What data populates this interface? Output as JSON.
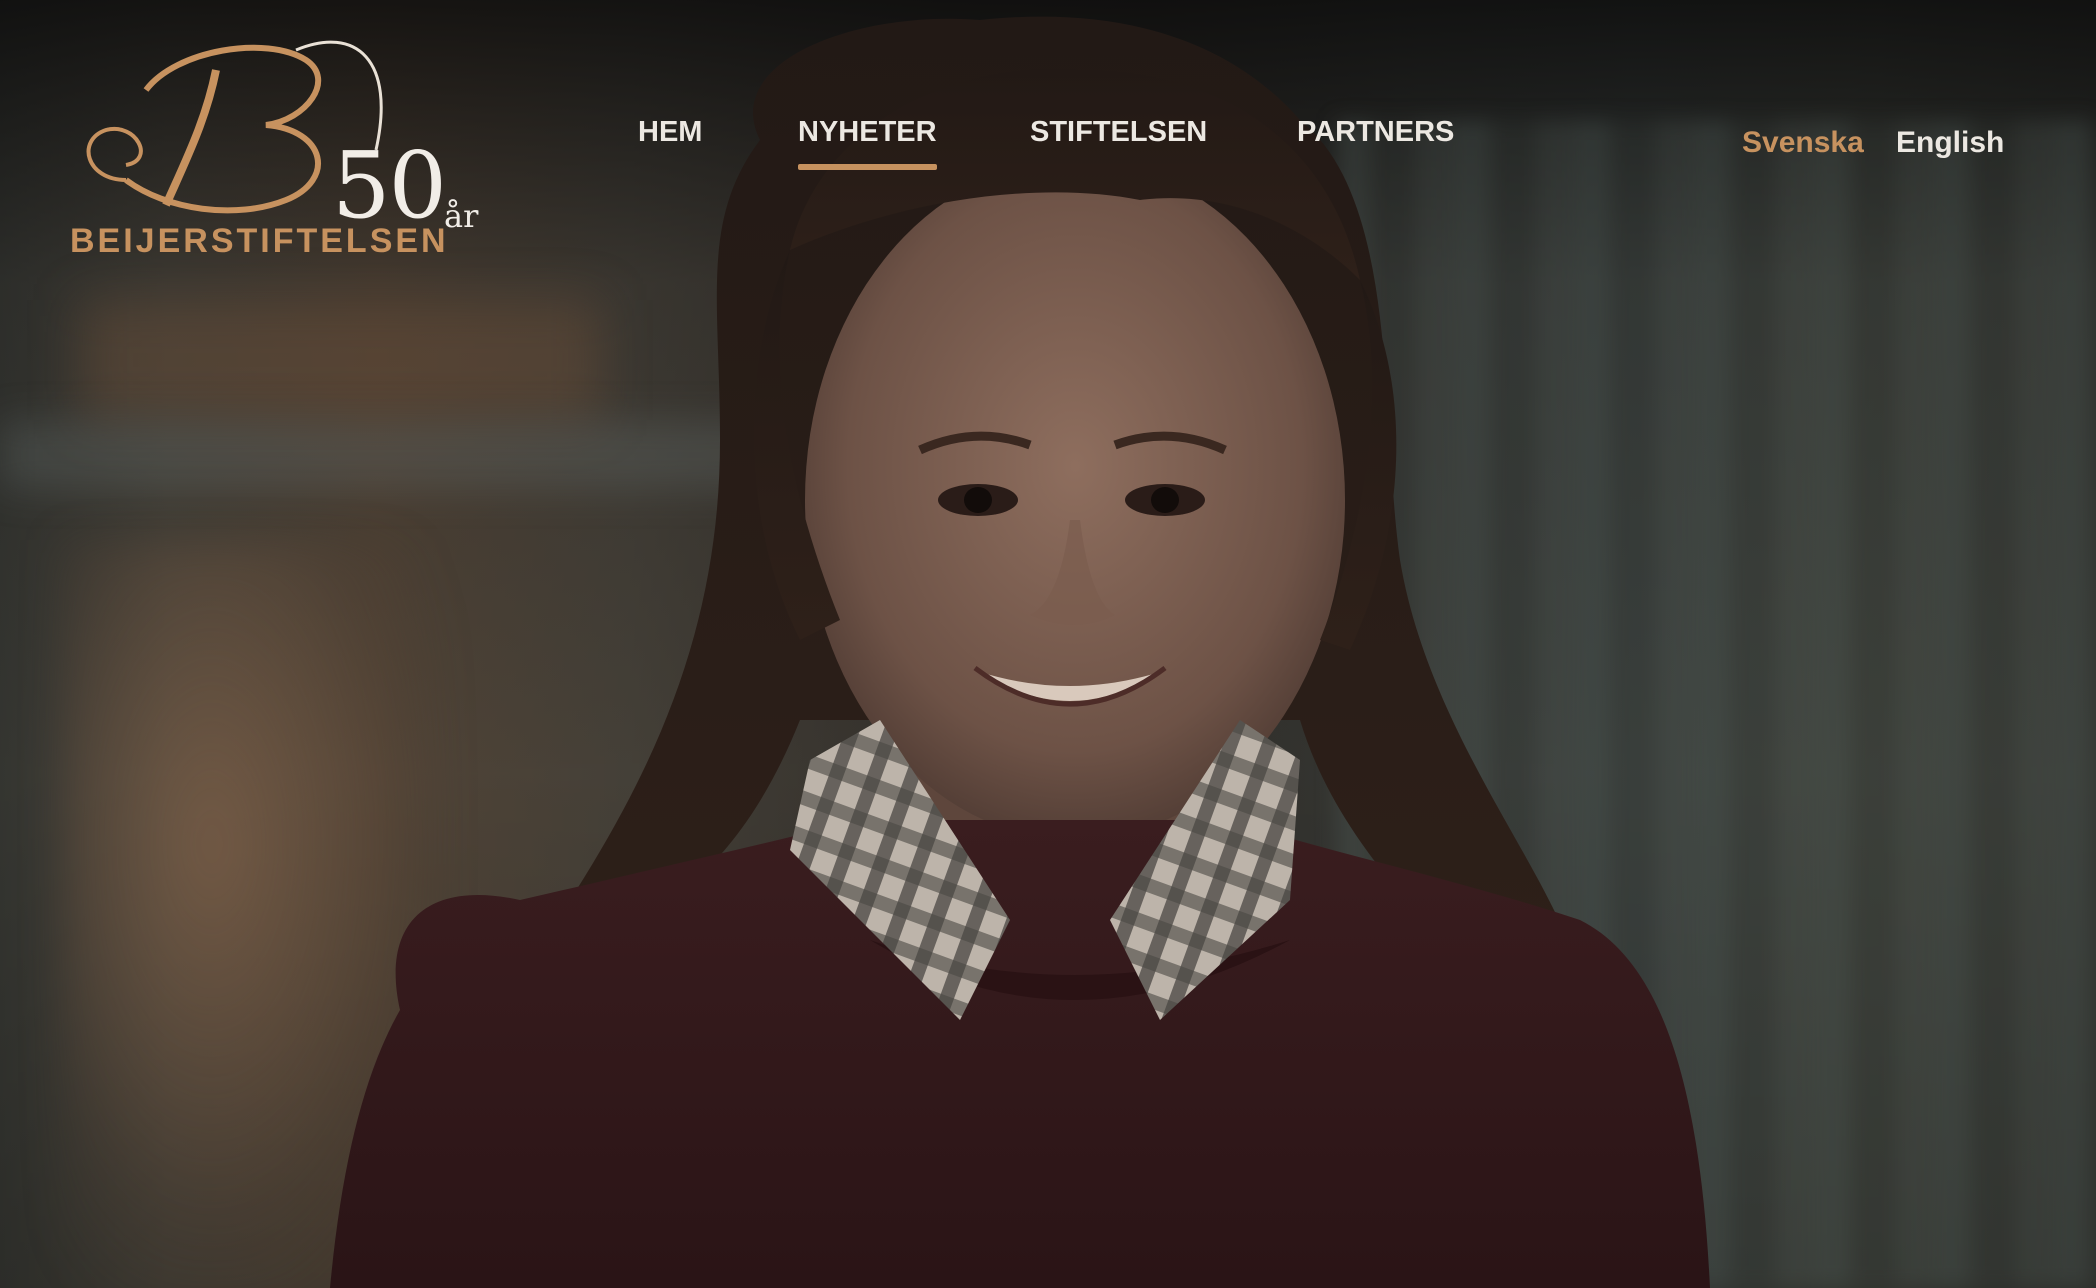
{
  "logo": {
    "monogram": "B",
    "years_number": "50",
    "years_suffix": "år",
    "wordmark": "BEIJERSTIFTELSEN"
  },
  "nav": {
    "items": [
      {
        "label": "HEM",
        "active": false
      },
      {
        "label": "NYHETER",
        "active": true
      },
      {
        "label": "STIFTELSEN",
        "active": false
      },
      {
        "label": "PARTNERS",
        "active": false
      }
    ]
  },
  "language": {
    "options": [
      {
        "label": "Svenska",
        "active": true
      },
      {
        "label": "English",
        "active": false
      }
    ]
  },
  "colors": {
    "accent": "#c7925f",
    "nav_text": "#ece8e2"
  }
}
